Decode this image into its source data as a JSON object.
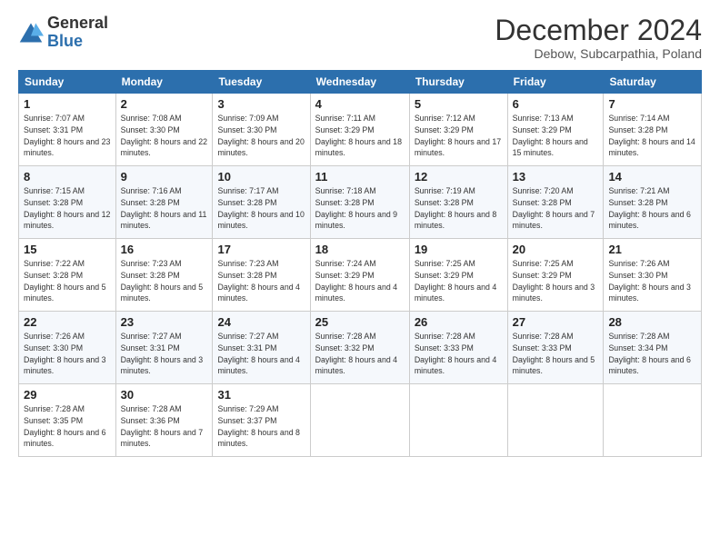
{
  "logo": {
    "general": "General",
    "blue": "Blue"
  },
  "header": {
    "month": "December 2024",
    "location": "Debow, Subcarpathia, Poland"
  },
  "weekdays": [
    "Sunday",
    "Monday",
    "Tuesday",
    "Wednesday",
    "Thursday",
    "Friday",
    "Saturday"
  ],
  "weeks": [
    [
      {
        "day": "1",
        "sunrise": "7:07 AM",
        "sunset": "3:31 PM",
        "daylight": "8 hours and 23 minutes."
      },
      {
        "day": "2",
        "sunrise": "7:08 AM",
        "sunset": "3:30 PM",
        "daylight": "8 hours and 22 minutes."
      },
      {
        "day": "3",
        "sunrise": "7:09 AM",
        "sunset": "3:30 PM",
        "daylight": "8 hours and 20 minutes."
      },
      {
        "day": "4",
        "sunrise": "7:11 AM",
        "sunset": "3:29 PM",
        "daylight": "8 hours and 18 minutes."
      },
      {
        "day": "5",
        "sunrise": "7:12 AM",
        "sunset": "3:29 PM",
        "daylight": "8 hours and 17 minutes."
      },
      {
        "day": "6",
        "sunrise": "7:13 AM",
        "sunset": "3:29 PM",
        "daylight": "8 hours and 15 minutes."
      },
      {
        "day": "7",
        "sunrise": "7:14 AM",
        "sunset": "3:28 PM",
        "daylight": "8 hours and 14 minutes."
      }
    ],
    [
      {
        "day": "8",
        "sunrise": "7:15 AM",
        "sunset": "3:28 PM",
        "daylight": "8 hours and 12 minutes."
      },
      {
        "day": "9",
        "sunrise": "7:16 AM",
        "sunset": "3:28 PM",
        "daylight": "8 hours and 11 minutes."
      },
      {
        "day": "10",
        "sunrise": "7:17 AM",
        "sunset": "3:28 PM",
        "daylight": "8 hours and 10 minutes."
      },
      {
        "day": "11",
        "sunrise": "7:18 AM",
        "sunset": "3:28 PM",
        "daylight": "8 hours and 9 minutes."
      },
      {
        "day": "12",
        "sunrise": "7:19 AM",
        "sunset": "3:28 PM",
        "daylight": "8 hours and 8 minutes."
      },
      {
        "day": "13",
        "sunrise": "7:20 AM",
        "sunset": "3:28 PM",
        "daylight": "8 hours and 7 minutes."
      },
      {
        "day": "14",
        "sunrise": "7:21 AM",
        "sunset": "3:28 PM",
        "daylight": "8 hours and 6 minutes."
      }
    ],
    [
      {
        "day": "15",
        "sunrise": "7:22 AM",
        "sunset": "3:28 PM",
        "daylight": "8 hours and 5 minutes."
      },
      {
        "day": "16",
        "sunrise": "7:23 AM",
        "sunset": "3:28 PM",
        "daylight": "8 hours and 5 minutes."
      },
      {
        "day": "17",
        "sunrise": "7:23 AM",
        "sunset": "3:28 PM",
        "daylight": "8 hours and 4 minutes."
      },
      {
        "day": "18",
        "sunrise": "7:24 AM",
        "sunset": "3:29 PM",
        "daylight": "8 hours and 4 minutes."
      },
      {
        "day": "19",
        "sunrise": "7:25 AM",
        "sunset": "3:29 PM",
        "daylight": "8 hours and 4 minutes."
      },
      {
        "day": "20",
        "sunrise": "7:25 AM",
        "sunset": "3:29 PM",
        "daylight": "8 hours and 3 minutes."
      },
      {
        "day": "21",
        "sunrise": "7:26 AM",
        "sunset": "3:30 PM",
        "daylight": "8 hours and 3 minutes."
      }
    ],
    [
      {
        "day": "22",
        "sunrise": "7:26 AM",
        "sunset": "3:30 PM",
        "daylight": "8 hours and 3 minutes."
      },
      {
        "day": "23",
        "sunrise": "7:27 AM",
        "sunset": "3:31 PM",
        "daylight": "8 hours and 3 minutes."
      },
      {
        "day": "24",
        "sunrise": "7:27 AM",
        "sunset": "3:31 PM",
        "daylight": "8 hours and 4 minutes."
      },
      {
        "day": "25",
        "sunrise": "7:28 AM",
        "sunset": "3:32 PM",
        "daylight": "8 hours and 4 minutes."
      },
      {
        "day": "26",
        "sunrise": "7:28 AM",
        "sunset": "3:33 PM",
        "daylight": "8 hours and 4 minutes."
      },
      {
        "day": "27",
        "sunrise": "7:28 AM",
        "sunset": "3:33 PM",
        "daylight": "8 hours and 5 minutes."
      },
      {
        "day": "28",
        "sunrise": "7:28 AM",
        "sunset": "3:34 PM",
        "daylight": "8 hours and 6 minutes."
      }
    ],
    [
      {
        "day": "29",
        "sunrise": "7:28 AM",
        "sunset": "3:35 PM",
        "daylight": "8 hours and 6 minutes."
      },
      {
        "day": "30",
        "sunrise": "7:28 AM",
        "sunset": "3:36 PM",
        "daylight": "8 hours and 7 minutes."
      },
      {
        "day": "31",
        "sunrise": "7:29 AM",
        "sunset": "3:37 PM",
        "daylight": "8 hours and 8 minutes."
      },
      null,
      null,
      null,
      null
    ]
  ],
  "labels": {
    "sunrise": "Sunrise:",
    "sunset": "Sunset:",
    "daylight": "Daylight:"
  }
}
